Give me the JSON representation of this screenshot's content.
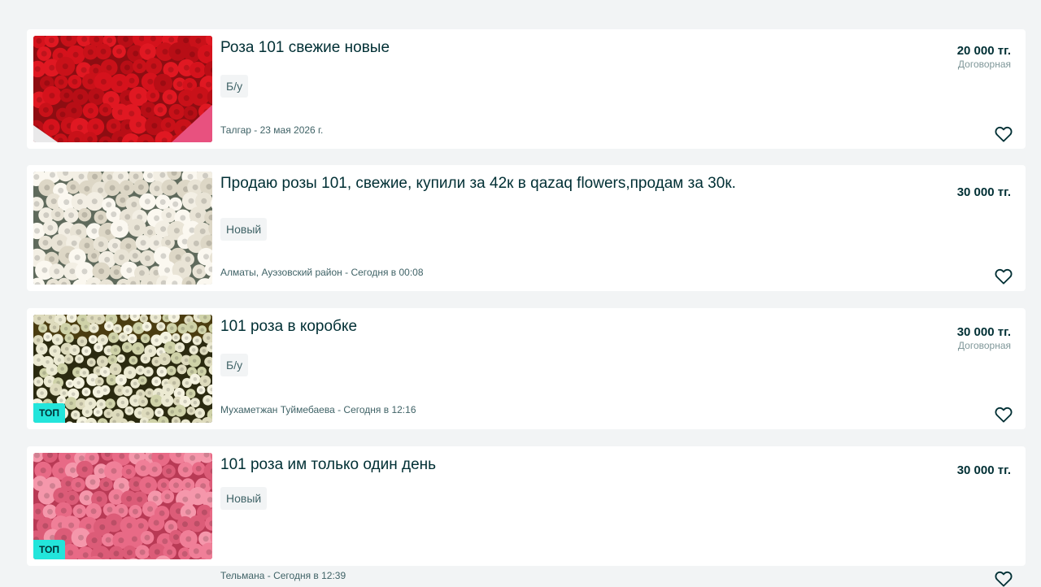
{
  "listings": [
    {
      "title": "Роза 101 свежие новые",
      "condition": "Б/у",
      "location_date": "Талгар - 23 мая 2026 г.",
      "price": "20 000 тг.",
      "price_note": "Договорная",
      "top": false,
      "image": "red-roses"
    },
    {
      "title": "Продаю розы 101, свежие, купили за 42к в qazaq flowers,продам за 30к.",
      "condition": "Новый",
      "location_date": "Алматы, Ауэзовский район - Сегодня в 00:08",
      "price": "30 000 тг.",
      "price_note": "",
      "top": false,
      "image": "white-roses"
    },
    {
      "title": "101 роза в коробке",
      "condition": "Б/у",
      "location_date": "Мухаметжан Туймебаева - Сегодня в 12:16",
      "price": "30 000 тг.",
      "price_note": "Договорная",
      "top": true,
      "top_label": "ТОП",
      "image": "cream-roses-box"
    },
    {
      "title": "101 роза им только один день",
      "condition": "Новый",
      "location_date": "Тельмана - Сегодня в 12:39",
      "price": "30 000 тг.",
      "price_note": "",
      "top": true,
      "top_label": "ТОП",
      "image": "pink-roses"
    }
  ],
  "colors": {
    "background": "#f2f4f5",
    "card": "#ffffff",
    "text_primary": "#002f34",
    "text_secondary": "#406367",
    "top_badge": "#23e5db"
  },
  "icons": {
    "favorite": "heart-outline-icon"
  }
}
